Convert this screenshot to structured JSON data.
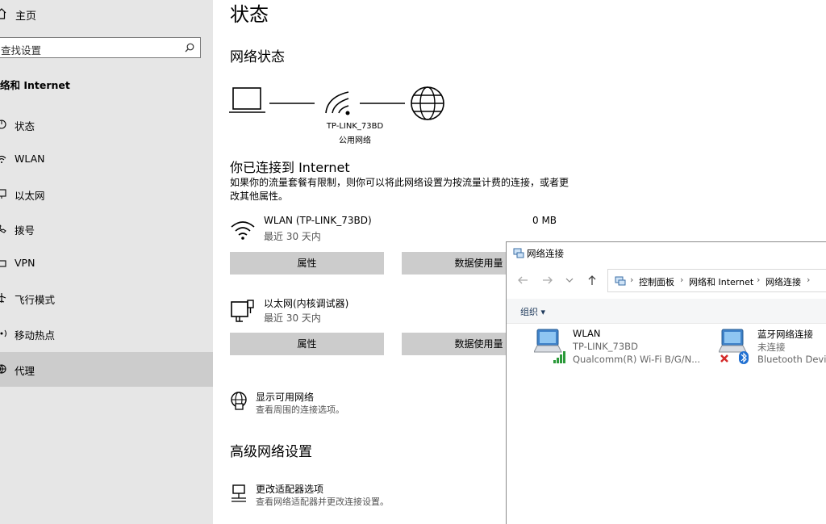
{
  "sidebar": {
    "home": {
      "label": "主页",
      "icon": "home-icon"
    },
    "search": {
      "placeholder": "查找设置",
      "icon": "search-icon"
    },
    "section_title": "络和 Internet",
    "items": [
      {
        "label": "状态",
        "icon": "status-icon"
      },
      {
        "label": "WLAN",
        "icon": "wifi-icon"
      },
      {
        "label": "以太网",
        "icon": "ethernet-icon"
      },
      {
        "label": "拨号",
        "icon": "dialup-icon"
      },
      {
        "label": "VPN",
        "icon": "vpn-icon"
      },
      {
        "label": "飞行模式",
        "icon": "airplane-icon"
      },
      {
        "label": "移动热点",
        "icon": "hotspot-icon"
      },
      {
        "label": "代理",
        "icon": "proxy-icon"
      }
    ]
  },
  "main": {
    "page_title": "状态",
    "network_status_title": "网络状态",
    "diagram": {
      "ssid": "TP-LINK_73BD",
      "network_type": "公用网络"
    },
    "connected_title": "你已连接到 Internet",
    "connected_desc": "如果你的流量套餐有限制，则你可以将此网络设置为按流量计费的连接，或者更改其他属性。",
    "connections": [
      {
        "name": "WLAN (TP-LINK_73BD)",
        "sub": "最近 30 天内",
        "usage": "0 MB",
        "properties": "属性",
        "data_usage": "数据使用量"
      },
      {
        "name": "以太网(内核调试器)",
        "sub": "最近 30 天内",
        "properties": "属性",
        "data_usage": "数据使用量"
      }
    ],
    "show_networks": {
      "title": "显示可用网络",
      "desc": "查看周围的连接选项。"
    },
    "advanced_title": "高级网络设置",
    "adapter_options": {
      "title": "更改适配器选项",
      "desc": "查看网络适配器并更改连接设置。"
    }
  },
  "explorer": {
    "title": "网络连接",
    "breadcrumbs": [
      "控制面板",
      "网络和 Internet",
      "网络连接"
    ],
    "organize": "组织",
    "items": [
      {
        "name": "WLAN",
        "status": "TP-LINK_73BD",
        "device": "Qualcomm(R) Wi-Fi B/G/N..."
      },
      {
        "name": "蓝牙网络连接",
        "status": "未连接",
        "device": "Bluetooth Device"
      }
    ]
  },
  "colors": {
    "sidebar_bg": "#e6e6e6",
    "active_item": "#cccccc",
    "button_bg": "#cccccc",
    "accent_blue": "#0063b1"
  }
}
